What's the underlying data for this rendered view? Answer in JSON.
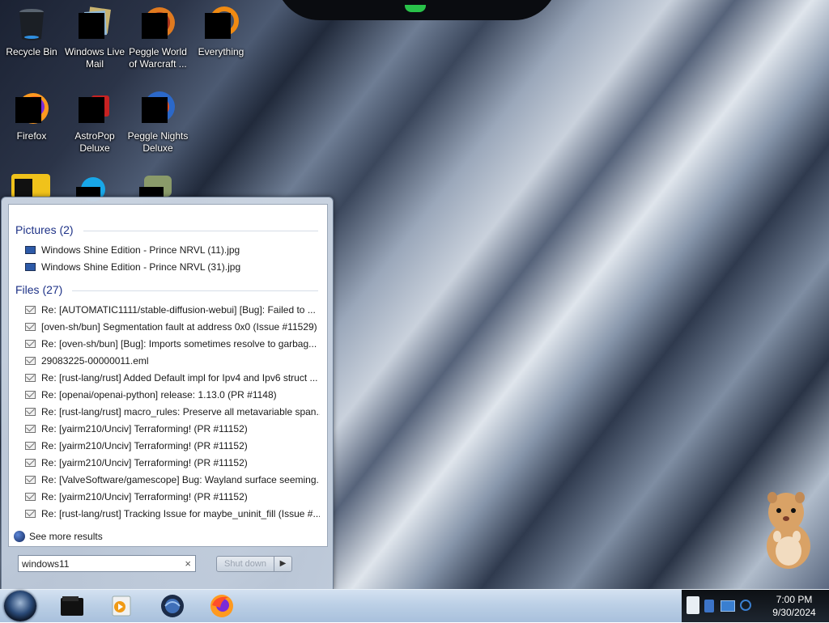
{
  "desktop": {
    "icons": [
      {
        "label": "Recycle Bin",
        "icon": "recycle-bin-icon"
      },
      {
        "label": "Windows Live Mail",
        "icon": "windows-live-mail-icon"
      },
      {
        "label": "Peggle World of Warcraft ...",
        "icon": "peggle-wow-icon"
      },
      {
        "label": "Everything",
        "icon": "everything-icon"
      },
      {
        "label": "Firefox",
        "icon": "firefox-icon"
      },
      {
        "label": "AstroPop Deluxe",
        "icon": "astropop-icon"
      },
      {
        "label": "Peggle Nights Deluxe",
        "icon": "peggle-nights-icon"
      }
    ]
  },
  "start_menu": {
    "groups": [
      {
        "title": "Pictures (2)",
        "items": [
          "Windows Shine Edition - Prince NRVL (11).jpg",
          "Windows Shine Edition - Prince NRVL (31).jpg"
        ]
      },
      {
        "title": "Files (27)",
        "items": [
          "Re: [AUTOMATIC1111/stable-diffusion-webui] [Bug]: Failed to ...",
          "[oven-sh/bun] Segmentation fault at address 0x0 (Issue #11529)",
          "Re: [oven-sh/bun] [Bug]: Imports sometimes resolve to garbag...",
          "29083225-00000011.eml",
          "Re: [rust-lang/rust] Added Default impl for Ipv4 and Ipv6 struct ...",
          "Re: [openai/openai-python] release: 1.13.0 (PR #1148)",
          "Re: [rust-lang/rust] macro_rules: Preserve all metavariable span...",
          "Re: [yairm210/Unciv] Terraforming! (PR #11152)",
          "Re: [yairm210/Unciv] Terraforming! (PR #11152)",
          "Re: [yairm210/Unciv] Terraforming! (PR #11152)",
          "Re: [ValveSoftware/gamescope] Bug: Wayland surface seeming...",
          "Re: [yairm210/Unciv] Terraforming! (PR #11152)",
          "Re: [rust-lang/rust] Tracking Issue for maybe_uninit_fill (Issue #..."
        ]
      }
    ],
    "see_more": "See more results",
    "search_value": "windows11",
    "clear_glyph": "×",
    "shutdown_label": "Shut down",
    "shutdown_arrow": "▶"
  },
  "taskbar": {
    "buttons": [
      "explorer-icon",
      "media-player-icon",
      "browser-icon",
      "firefox-icon"
    ],
    "clock": {
      "time": "7:00 PM",
      "date": "9/30/2024"
    }
  }
}
